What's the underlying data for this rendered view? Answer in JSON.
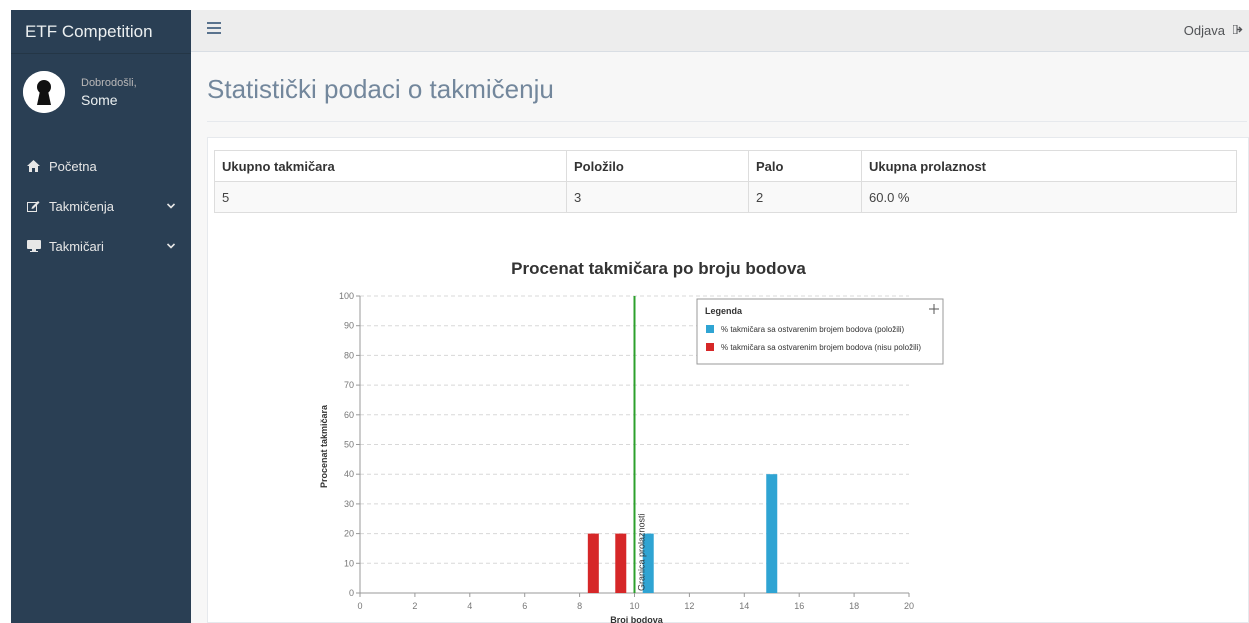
{
  "app": {
    "title": "ETF Competition"
  },
  "profile": {
    "welcome": "Dobrodošli,",
    "name": "Some"
  },
  "sidebar": {
    "items": [
      {
        "label": "Početna",
        "icon": "home-icon"
      },
      {
        "label": "Takmičenja",
        "icon": "edit-icon",
        "chevron": "chevron-down-icon"
      },
      {
        "label": "Takmičari",
        "icon": "monitor-icon",
        "chevron": "chevron-down-icon"
      }
    ]
  },
  "topbar": {
    "logout_label": "Odjava"
  },
  "page": {
    "title": "Statistički podaci o takmičenju"
  },
  "stats_table": {
    "headers": [
      "Ukupno takmičara",
      "Položilo",
      "Palo",
      "Ukupna prolaznost"
    ],
    "row": [
      "5",
      "3",
      "2",
      "60.0 %"
    ]
  },
  "chart_data": {
    "type": "bar",
    "title": "Procenat takmičara po broju bodova",
    "xlabel": "Broj bodova",
    "ylabel": "Procenat takmičara",
    "xlim": [
      0,
      20
    ],
    "ylim": [
      0,
      100
    ],
    "x_ticks": [
      0,
      2,
      4,
      6,
      8,
      10,
      12,
      14,
      16,
      18,
      20
    ],
    "y_ticks": [
      0,
      10,
      20,
      30,
      40,
      50,
      60,
      70,
      80,
      90,
      100
    ],
    "grid": true,
    "legend": {
      "title": "Legenda",
      "placement": "top-right"
    },
    "threshold": {
      "x": 10,
      "label": "Granica prolaznosti",
      "color": "#2ca02c"
    },
    "series": [
      {
        "name": "% takmičara sa ostvarenim brojem bodova (položili)",
        "color": "#2fa4d3",
        "points": [
          {
            "x": 10.5,
            "y": 20
          },
          {
            "x": 15,
            "y": 40
          }
        ]
      },
      {
        "name": "% takmičara sa ostvarenim brojem bodova (nisu položili)",
        "color": "#d62728",
        "points": [
          {
            "x": 8.5,
            "y": 20
          },
          {
            "x": 9.5,
            "y": 20
          }
        ]
      }
    ]
  }
}
